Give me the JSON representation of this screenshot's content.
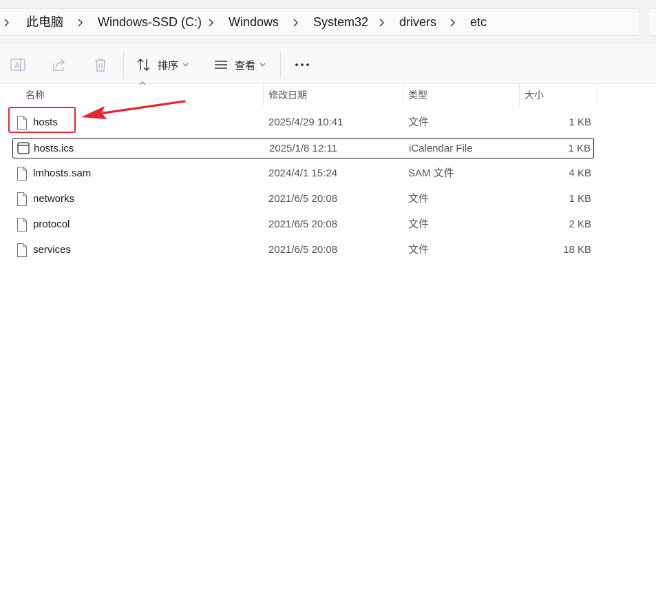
{
  "breadcrumb": {
    "items": [
      "此电脑",
      "Windows-SSD (C:)",
      "Windows",
      "System32",
      "drivers",
      "etc"
    ]
  },
  "toolbar": {
    "rename_icon": "rename-icon",
    "share_icon": "share-icon",
    "delete_icon": "trash-icon",
    "sort_label": "排序",
    "view_label": "查看",
    "more_label": "..."
  },
  "columns": {
    "name": "名称",
    "date": "修改日期",
    "type": "类型",
    "size": "大小"
  },
  "files": [
    {
      "name": "hosts",
      "date": "2025/4/29 10:41",
      "type": "文件",
      "size": "1 KB",
      "icon": "file-icon"
    },
    {
      "name": "hosts.ics",
      "date": "2025/1/8 12:11",
      "type": "iCalendar File",
      "size": "1 KB",
      "icon": "calendar-file-icon"
    },
    {
      "name": "lmhosts.sam",
      "date": "2024/4/1 15:24",
      "type": "SAM 文件",
      "size": "4 KB",
      "icon": "file-icon"
    },
    {
      "name": "networks",
      "date": "2021/6/5 20:08",
      "type": "文件",
      "size": "1 KB",
      "icon": "file-icon"
    },
    {
      "name": "protocol",
      "date": "2021/6/5 20:08",
      "type": "文件",
      "size": "2 KB",
      "icon": "file-icon"
    },
    {
      "name": "services",
      "date": "2021/6/5 20:08",
      "type": "文件",
      "size": "18 KB",
      "icon": "file-icon"
    }
  ],
  "annotation": {
    "color": "#e3262d",
    "target": "hosts"
  }
}
